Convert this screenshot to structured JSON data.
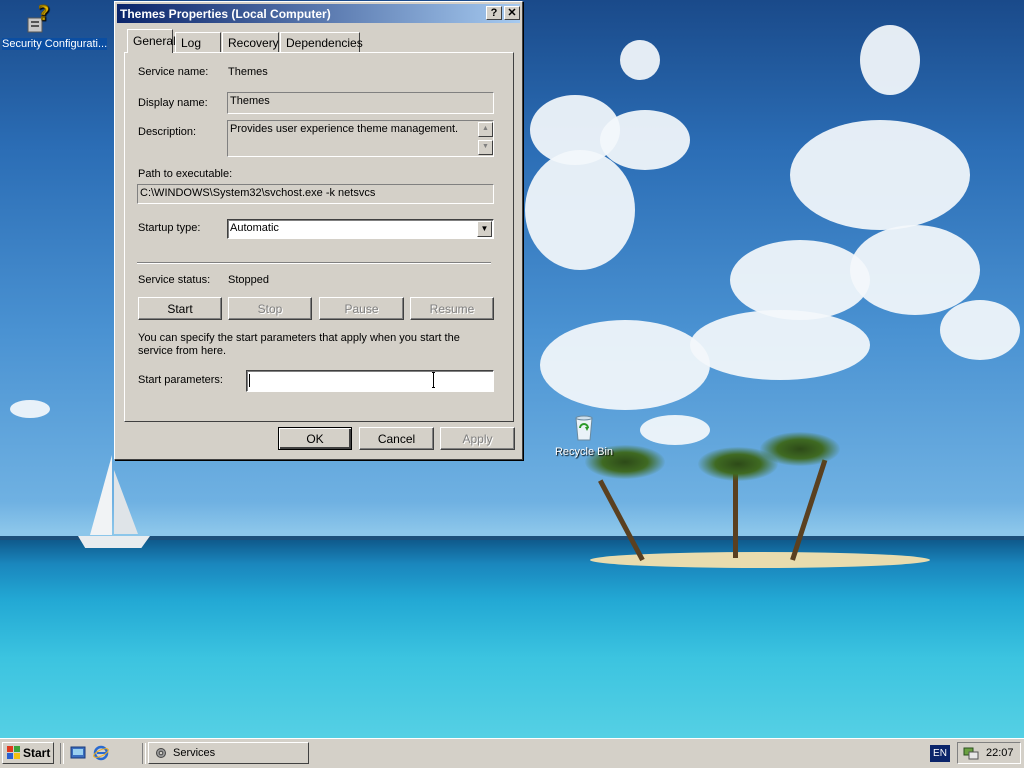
{
  "desktop": {
    "icons": [
      {
        "label": "Security Configurati..."
      },
      {
        "label": "Recycle Bin"
      }
    ]
  },
  "dialog": {
    "title": "Themes Properties (Local Computer)",
    "help_btn": "?",
    "close_btn": "✕",
    "tabs": [
      "General",
      "Log On",
      "Recovery",
      "Dependencies"
    ],
    "active_tab": "General",
    "service_name_label": "Service name:",
    "service_name_value": "Themes",
    "display_name_label": "Display name:",
    "display_name_value": "Themes",
    "description_label": "Description:",
    "description_value": "Provides user experience theme management.",
    "path_label": "Path to executable:",
    "path_value": "C:\\WINDOWS\\System32\\svchost.exe -k netsvcs",
    "startup_type_label": "Startup type:",
    "startup_type_value": "Automatic",
    "service_status_label": "Service status:",
    "service_status_value": "Stopped",
    "control_buttons": {
      "start": "Start",
      "stop": "Stop",
      "pause": "Pause",
      "resume": "Resume"
    },
    "info_text": "You can specify the start parameters that apply when you start the service from here.",
    "start_params_label": "Start parameters:",
    "start_params_value": "",
    "footer_buttons": {
      "ok": "OK",
      "cancel": "Cancel",
      "apply": "Apply"
    }
  },
  "taskbar": {
    "start_label": "Start",
    "tasks": [
      {
        "label": "Services"
      }
    ],
    "language": "EN",
    "clock": "22:07"
  }
}
